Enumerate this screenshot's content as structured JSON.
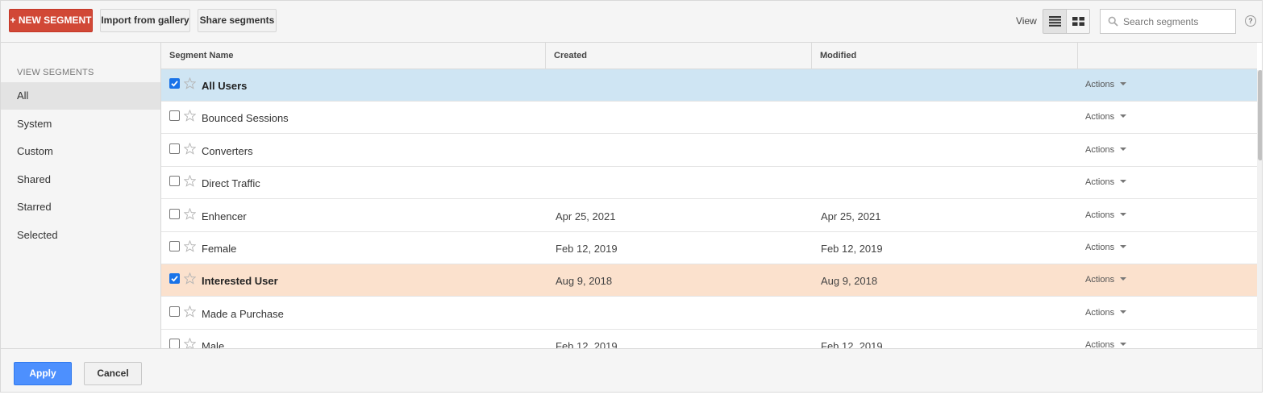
{
  "toolbar": {
    "new_segment_label": "+ NEW SEGMENT",
    "import_label": "Import from gallery",
    "share_label": "Share segments",
    "view_label": "View",
    "search_placeholder": "Search segments",
    "help_label": "?"
  },
  "sidebar": {
    "heading": "VIEW SEGMENTS",
    "items": [
      {
        "label": "All",
        "active": true
      },
      {
        "label": "System"
      },
      {
        "label": "Custom"
      },
      {
        "label": "Shared"
      },
      {
        "label": "Starred"
      },
      {
        "label": "Selected"
      }
    ]
  },
  "table": {
    "columns": {
      "name": "Segment Name",
      "created": "Created",
      "modified": "Modified"
    },
    "actions_label": "Actions",
    "rows": [
      {
        "name": "All Users",
        "created": "",
        "modified": "",
        "checked": true,
        "highlight": "blue"
      },
      {
        "name": "Bounced Sessions",
        "created": "",
        "modified": "",
        "checked": false
      },
      {
        "name": "Converters",
        "created": "",
        "modified": "",
        "checked": false
      },
      {
        "name": "Direct Traffic",
        "created": "",
        "modified": "",
        "checked": false
      },
      {
        "name": "Enhencer",
        "created": "Apr 25, 2021",
        "modified": "Apr 25, 2021",
        "checked": false
      },
      {
        "name": "Female",
        "created": "Feb 12, 2019",
        "modified": "Feb 12, 2019",
        "checked": false
      },
      {
        "name": "Interested User",
        "created": "Aug 9, 2018",
        "modified": "Aug 9, 2018",
        "checked": true,
        "highlight": "orange"
      },
      {
        "name": "Made a Purchase",
        "created": "",
        "modified": "",
        "checked": false
      },
      {
        "name": "Male",
        "created": "Feb 12, 2019",
        "modified": "Feb 12, 2019",
        "checked": false
      }
    ]
  },
  "footer": {
    "apply_label": "Apply",
    "cancel_label": "Cancel"
  },
  "colors": {
    "new_segment_bg": "#d14836",
    "apply_bg": "#4d90fe",
    "selected_blue": "#cfe5f3",
    "selected_orange": "#fbe1cd"
  }
}
